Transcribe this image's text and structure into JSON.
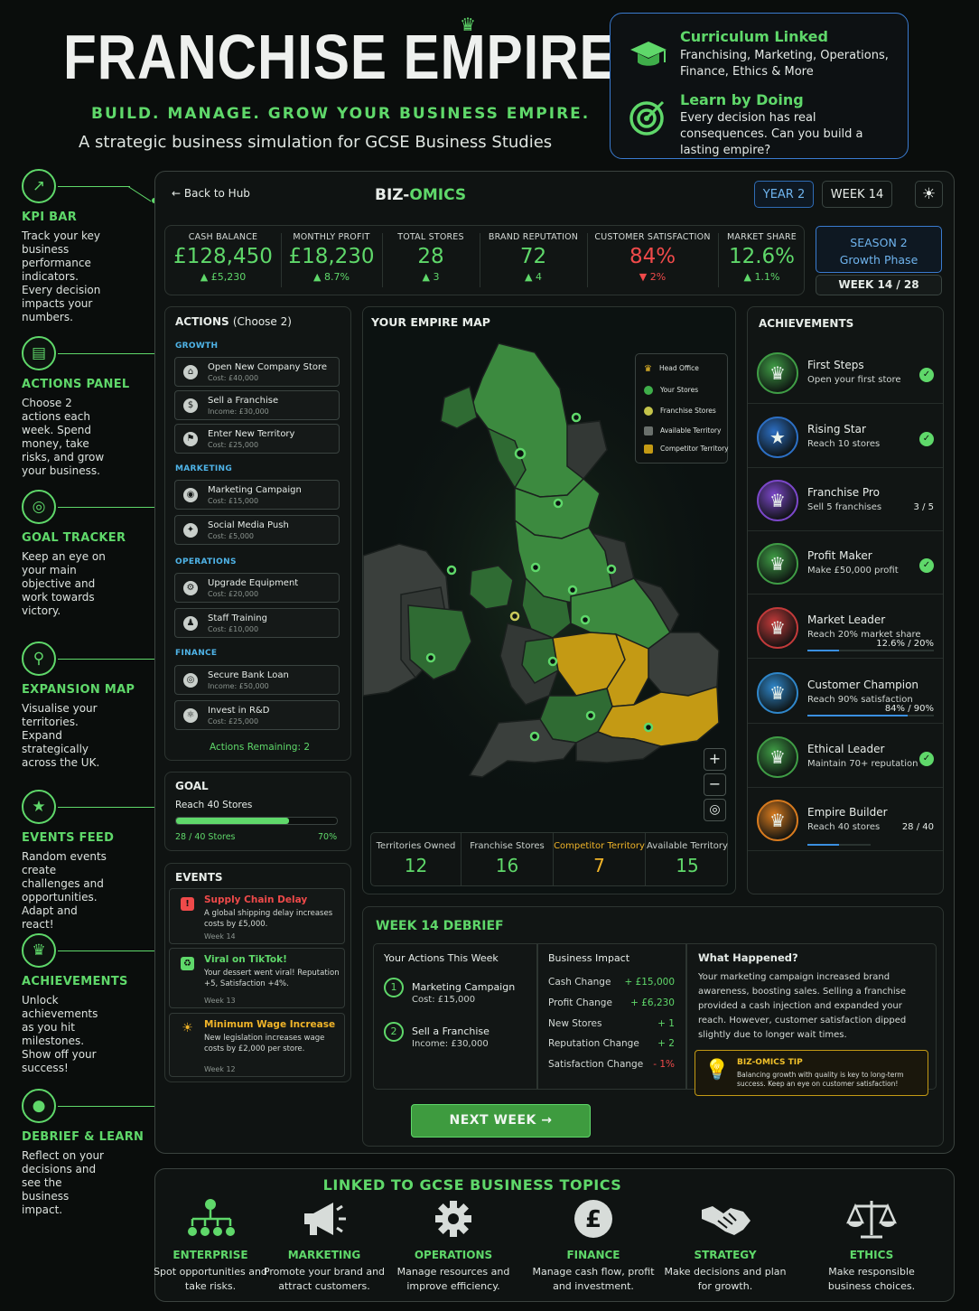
{
  "header": {
    "title": "FRANCHISE EMPIRE",
    "tagline": "BUILD. MANAGE. GROW YOUR BUSINESS EMPIRE.",
    "subtitle": "A strategic business simulation for GCSE Business Studies"
  },
  "curriculum": {
    "h1": "Curriculum Linked",
    "t1": "Franchising, Marketing, Operations, Finance, Ethics & More",
    "h2": "Learn by Doing",
    "t2": "Every decision has real consequences. Can you build a lasting empire?"
  },
  "rail": [
    {
      "title": "KPI BAR",
      "text": "Track your key business performance indicators. Every decision impacts your numbers.",
      "icon": "chart-icon"
    },
    {
      "title": "ACTIONS PANEL",
      "text": "Choose 2 actions each week. Spend money, take risks, and grow your business.",
      "icon": "clipboard-icon"
    },
    {
      "title": "GOAL TRACKER",
      "text": "Keep an eye on your main objective and work towards victory.",
      "icon": "target-icon"
    },
    {
      "title": "EXPANSION MAP",
      "text": "Visualise your territories. Expand strategically across the UK.",
      "icon": "map-pin-icon"
    },
    {
      "title": "EVENTS FEED",
      "text": "Random events create challenges and opportunities. Adapt and react!",
      "icon": "star-icon"
    },
    {
      "title": "ACHIEVEMENTS",
      "text": "Unlock achievements as you hit milestones. Show off your success!",
      "icon": "trophy-icon"
    },
    {
      "title": "DEBRIEF & LEARN",
      "text": "Reflect on your decisions and see the business impact.",
      "icon": "chat-icon"
    }
  ],
  "topbar": {
    "back": "← Back to Hub",
    "brand_a": "BIZ-",
    "brand_b": "OMICS",
    "year": "YEAR 2",
    "week": "WEEK 14",
    "theme_icon": "sun-icon"
  },
  "kpis": [
    {
      "label": "CASH BALANCE",
      "value": "£128,450",
      "delta": "▲ £5,230",
      "color": "#5fd86a"
    },
    {
      "label": "MONTHLY PROFIT",
      "value": "£18,230",
      "delta": "▲ 8.7%",
      "color": "#5fd86a"
    },
    {
      "label": "TOTAL STORES",
      "value": "28",
      "delta": "▲ 3",
      "color": "#5fd86a"
    },
    {
      "label": "BRAND REPUTATION",
      "value": "72",
      "delta": "▲ 4",
      "color": "#5fd86a"
    },
    {
      "label": "CUSTOMER SATISFACTION",
      "value": "84%",
      "delta": "▼ 2%",
      "color": "#ef4a4a"
    },
    {
      "label": "MARKET SHARE",
      "value": "12.6%",
      "delta": "▲ 1.1%",
      "color": "#5fd86a"
    }
  ],
  "season": {
    "title": "SEASON 2",
    "phase": "Growth Phase",
    "week": "WEEK 14 / 28"
  },
  "actions": {
    "title": "ACTIONS",
    "choose": "(Choose 2)",
    "groups": [
      {
        "name": "GROWTH",
        "items": [
          {
            "name": "Open New Company Store",
            "cost": "Cost: £40,000"
          },
          {
            "name": "Sell a Franchise",
            "cost": "Income: £30,000"
          },
          {
            "name": "Enter New Territory",
            "cost": "Cost: £25,000"
          }
        ]
      },
      {
        "name": "MARKETING",
        "items": [
          {
            "name": "Marketing Campaign",
            "cost": "Cost: £15,000"
          },
          {
            "name": "Social Media Push",
            "cost": "Cost: £5,000"
          }
        ]
      },
      {
        "name": "OPERATIONS",
        "items": [
          {
            "name": "Upgrade Equipment",
            "cost": "Cost: £20,000"
          },
          {
            "name": "Staff Training",
            "cost": "Cost: £10,000"
          }
        ]
      },
      {
        "name": "FINANCE",
        "items": [
          {
            "name": "Secure Bank Loan",
            "cost": "Income: £50,000"
          },
          {
            "name": "Invest in R&D",
            "cost": "Cost: £25,000"
          }
        ]
      }
    ],
    "remaining": "Actions Remaining: 2"
  },
  "goal": {
    "title": "GOAL",
    "text": "Reach 40 Stores",
    "progress_label": "28 / 40 Stores",
    "percent_label": "70%",
    "progress": 0.7
  },
  "events": {
    "title": "EVENTS",
    "items": [
      {
        "title": "Supply Chain Delay",
        "desc": "A global shipping delay increases costs by £5,000.",
        "week": "Week 14",
        "color": "#ef4a4a"
      },
      {
        "title": "Viral on TikTok!",
        "desc": "Your dessert went viral! Reputation +5, Satisfaction +4%.",
        "week": "Week 13",
        "color": "#5fd86a"
      },
      {
        "title": "Minimum Wage Increase",
        "desc": "New legislation increases wage costs by £2,000 per store.",
        "week": "Week 12",
        "color": "#f0b429"
      }
    ]
  },
  "map": {
    "title": "YOUR EMPIRE MAP",
    "legend": [
      "Head Office",
      "Your Stores",
      "Franchise Stores",
      "Available Territory",
      "Competitor Territory"
    ],
    "stats": [
      {
        "label": "Territories Owned",
        "value": "12",
        "color": "#c9d0cc"
      },
      {
        "label": "Franchise Stores",
        "value": "16",
        "color": "#c9d0cc"
      },
      {
        "label": "Competitor Territory",
        "value": "7",
        "color": "#f0b429"
      },
      {
        "label": "Available Territory",
        "value": "15",
        "color": "#c9d0cc"
      }
    ]
  },
  "achievements": {
    "title": "ACHIEVEMENTS",
    "items": [
      {
        "name": "First Steps",
        "desc": "Open your first store",
        "done": true,
        "progress": "",
        "color": "#3f9c45",
        "icon": "trophy-icon"
      },
      {
        "name": "Rising Star",
        "desc": "Reach 10 stores",
        "done": true,
        "progress": "",
        "color": "#2c6fc4",
        "icon": "star-icon"
      },
      {
        "name": "Franchise Pro",
        "desc": "Sell 5 franchises",
        "done": false,
        "progress": "3 / 5",
        "color": "#7b47c9",
        "icon": "trophy-icon"
      },
      {
        "name": "Profit Maker",
        "desc": "Make £50,000 profit",
        "done": true,
        "progress": "",
        "color": "#3f9c45",
        "icon": "trophy-icon"
      },
      {
        "name": "Market Leader",
        "desc": "Reach 20% market share",
        "done": false,
        "progress": "12.6% / 20%",
        "color": "#c23a3a",
        "icon": "trophy-icon",
        "bar": 0.63
      },
      {
        "name": "Customer Champion",
        "desc": "Reach 90% satisfaction",
        "done": false,
        "progress": "84% / 90%",
        "color": "#2f86c9",
        "icon": "trophy-icon",
        "bar": 0.93
      },
      {
        "name": "Ethical Leader",
        "desc": "Maintain 70+ reputation",
        "done": true,
        "progress": "",
        "color": "#3f9c45",
        "icon": "trophy-icon"
      },
      {
        "name": "Empire Builder",
        "desc": "Reach 40 stores",
        "done": false,
        "progress": "28 / 40",
        "color": "#d77a1e",
        "icon": "trophy-icon",
        "bar": 0.7
      }
    ]
  },
  "debrief": {
    "title": "WEEK 14 DEBRIEF",
    "actions_title": "Your Actions This Week",
    "actions": [
      {
        "n": "1",
        "name": "Marketing Campaign",
        "cost": "Cost: £15,000"
      },
      {
        "n": "2",
        "name": "Sell a Franchise",
        "cost": "Income: £30,000"
      }
    ],
    "impact_title": "Business Impact",
    "impact": [
      {
        "label": "Cash Change",
        "value": "+ £15,000",
        "color": "#5fd86a"
      },
      {
        "label": "Profit Change",
        "value": "+ £6,230",
        "color": "#5fd86a"
      },
      {
        "label": "New Stores",
        "value": "+ 1",
        "color": "#5fd86a"
      },
      {
        "label": "Reputation Change",
        "value": "+ 2",
        "color": "#5fd86a"
      },
      {
        "label": "Satisfaction Change",
        "value": "- 1%",
        "color": "#ef4a4a"
      }
    ],
    "happened_title": "What Happened?",
    "happened": "Your marketing campaign increased brand awareness, boosting sales. Selling a franchise provided a cash injection and expanded your reach. However, customer satisfaction dipped slightly due to longer wait times.",
    "tip_title": "BIZ-OMICS TIP",
    "tip": "Balancing growth with quality is key to long-term success. Keep an eye on customer satisfaction!",
    "next": "NEXT WEEK →"
  },
  "topics": {
    "title": "LINKED TO GCSE BUSINESS TOPICS",
    "items": [
      {
        "name": "ENTERPRISE",
        "text": "Spot opportunities and take risks.",
        "icon": "network-icon"
      },
      {
        "name": "MARKETING",
        "text": "Promote your brand and attract customers.",
        "icon": "megaphone-icon"
      },
      {
        "name": "OPERATIONS",
        "text": "Manage resources and improve efficiency.",
        "icon": "gear-icon"
      },
      {
        "name": "FINANCE",
        "text": "Manage cash flow, profit and investment.",
        "icon": "pound-icon"
      },
      {
        "name": "STRATEGY",
        "text": "Make decisions and plan for growth.",
        "icon": "handshake-icon"
      },
      {
        "name": "ETHICS",
        "text": "Make responsible business choices.",
        "icon": "scales-icon"
      }
    ]
  }
}
